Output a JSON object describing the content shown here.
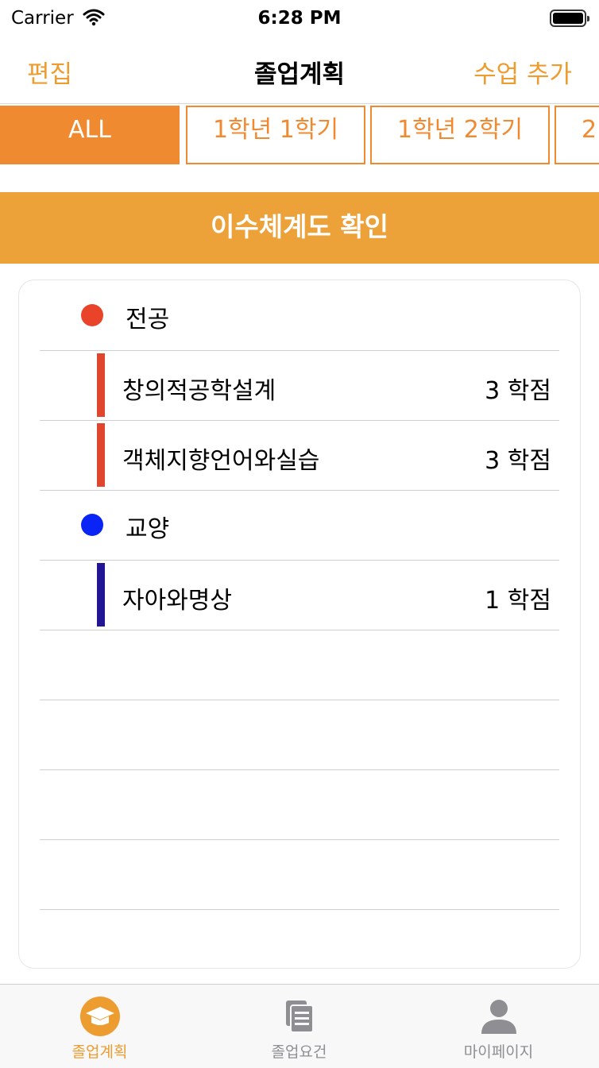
{
  "status": {
    "carrier": "Carrier",
    "time": "6:28 PM"
  },
  "nav": {
    "left": "편집",
    "title": "졸업계획",
    "right": "수업 추가"
  },
  "tabs": [
    {
      "label": "ALL"
    },
    {
      "label": "1학년 1학기"
    },
    {
      "label": "1학년 2학기"
    },
    {
      "label": "2"
    }
  ],
  "banner": {
    "label": "이수체계도 확인"
  },
  "plan": {
    "major": {
      "label": "전공",
      "color": "#E9432A",
      "courses": [
        {
          "name": "창의적공학설계",
          "credit": "3 학점"
        },
        {
          "name": "객체지향언어와실습",
          "credit": "3 학점"
        }
      ]
    },
    "general": {
      "label": "교양",
      "color": "#0A24F5",
      "courses": [
        {
          "name": "자아와명상",
          "credit": "1 학점",
          "bar_color": "#231694"
        }
      ]
    }
  },
  "tabbar": {
    "items": [
      {
        "label": "졸업계획",
        "icon": "graduation-cap-icon"
      },
      {
        "label": "졸업요건",
        "icon": "documents-icon"
      },
      {
        "label": "마이페이지",
        "icon": "person-icon"
      }
    ]
  },
  "colors": {
    "accent": "#F08A30",
    "banner": "#EDA239",
    "inactive": "#8E8E93"
  }
}
